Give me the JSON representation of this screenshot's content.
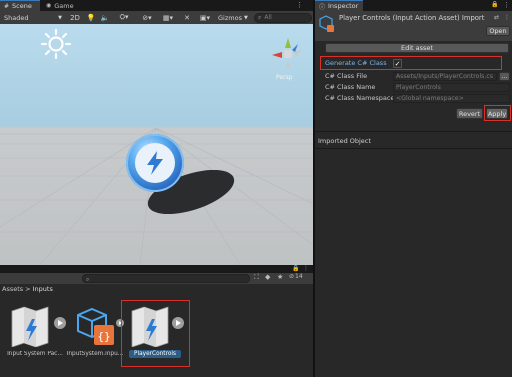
{
  "scene_panel": {
    "tabs": [
      {
        "label": "Scene",
        "icon": "hash-icon"
      },
      {
        "label": "Game",
        "icon": "gamepad-icon"
      }
    ],
    "toolbar": {
      "shading_mode": "Shaded",
      "toggle_2d": "2D",
      "gizmos": "Gizmos",
      "search_placeholder": "All"
    },
    "gizmo_view_label": "Persp"
  },
  "project_panel": {
    "search_placeholder": "",
    "hidden_count": "14",
    "breadcrumb": {
      "root": "Assets",
      "separator": ">",
      "current": "Inputs"
    },
    "assets": [
      {
        "name": "Input System Pac...",
        "icon": "input-system-package-icon"
      },
      {
        "name": "InputSystem.inpu...",
        "icon": "script-icon"
      },
      {
        "name": "PlayerControls",
        "icon": "input-actions-asset-icon",
        "selected": true
      }
    ]
  },
  "inspector": {
    "tab_label": "Inspector",
    "title": "Player Controls (Input Action Asset) Import",
    "open_label": "Open",
    "edit_asset_label": "Edit asset",
    "generate_class": {
      "label": "Generate C# Class",
      "checked": true
    },
    "fields": [
      {
        "label": "C# Class File",
        "value": "Assets/Inputs/PlayerControls.cs",
        "has_browse": true
      },
      {
        "label": "C# Class Name",
        "value": "PlayerControls"
      },
      {
        "label": "C# Class Namespace",
        "value": "<Global namespace>"
      }
    ],
    "revert_label": "Revert",
    "apply_label": "Apply",
    "imported_object_label": "Imported Object"
  },
  "colors": {
    "accent_blue": "#3a79bb",
    "highlight_red": "#d9302a",
    "ground": "#c3c7c9",
    "sky": "#aacde0"
  }
}
